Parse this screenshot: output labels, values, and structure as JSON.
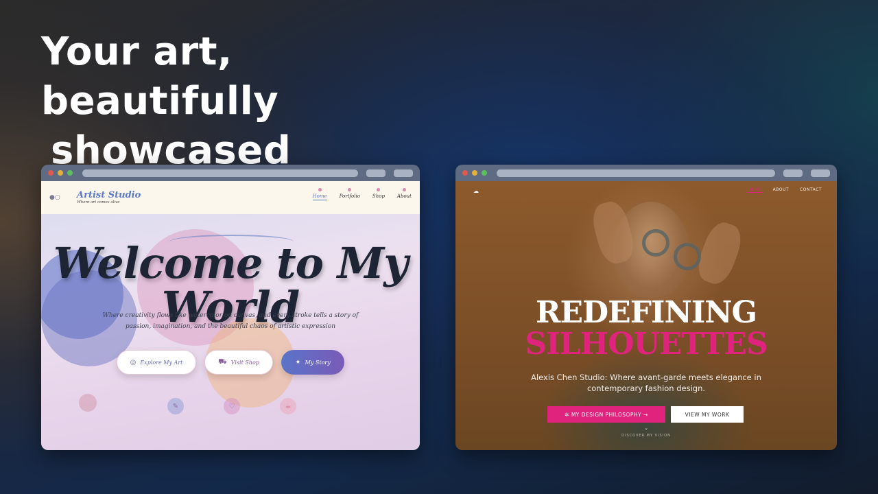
{
  "headline": {
    "line1": "Your art, beautifully",
    "line2": "showcased"
  },
  "left_site": {
    "nav_icon": "palette-icon",
    "brand_name": "Artist Studio",
    "brand_tagline": "Where art comes alive",
    "menu": [
      {
        "label": "Home",
        "active": true
      },
      {
        "label": "Portfolio",
        "active": false
      },
      {
        "label": "Shop",
        "active": false
      },
      {
        "label": "About",
        "active": false
      }
    ],
    "hero_line1": "Welcome to My",
    "hero_line2": "World",
    "tagline": "Where creativity flows like watercolor on canvas, and every stroke tells a story of passion, imagination, and the beautiful chaos of artistic expression",
    "buttons": [
      {
        "label": "Explore My Art",
        "icon": "palette-icon"
      },
      {
        "label": "Visit Shop",
        "icon": "cart-icon"
      },
      {
        "label": "My Story",
        "icon": "sparkle-icon"
      }
    ],
    "bottom_icons": [
      "brush-icon",
      "heart-icon",
      "coffee-icon"
    ]
  },
  "right_site": {
    "logo_icon": "logo-icon",
    "menu": [
      {
        "label": "HOME",
        "active": true
      },
      {
        "label": "ABOUT",
        "active": false
      },
      {
        "label": "CONTACT",
        "active": false
      }
    ],
    "title_line1": "REDEFINING",
    "title_line2": "SILHOUETTES",
    "subtitle": "Alexis Chen Studio: Where avant-garde meets elegance in contemporary fashion design.",
    "primary_button": "MY DESIGN PHILOSOPHY",
    "secondary_button": "VIEW MY WORK",
    "scroll_hint": "DISCOVER MY VISION"
  },
  "colors": {
    "accent_pink": "#e0247e",
    "accent_blue": "#5b79c8"
  }
}
